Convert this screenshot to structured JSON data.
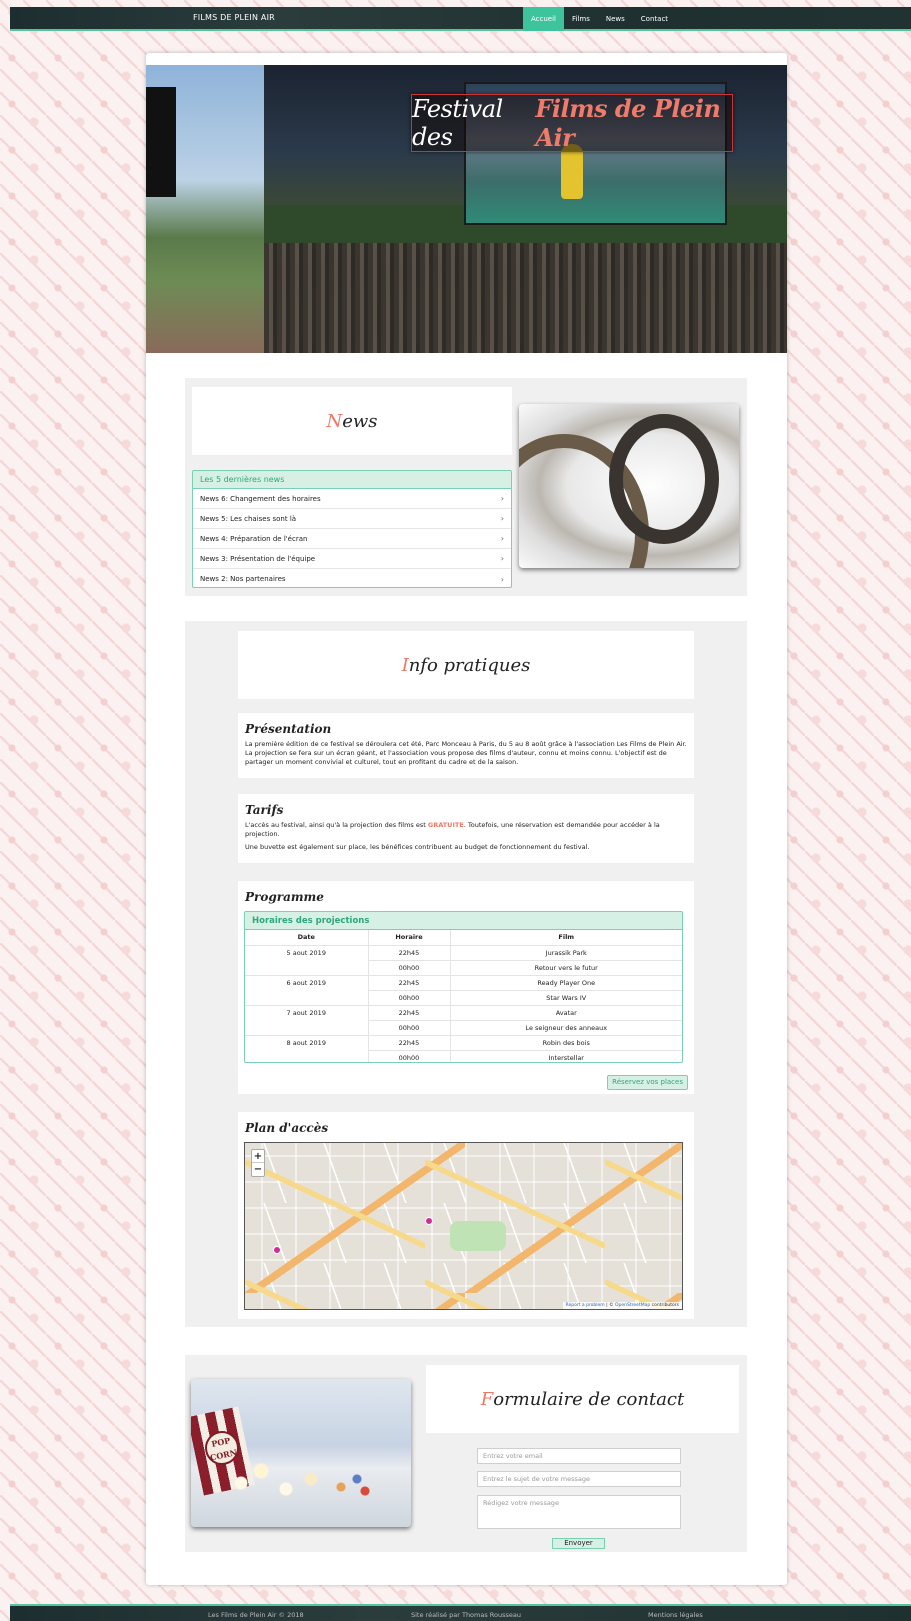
{
  "nav": {
    "brand": "FILMS DE PLEIN AIR",
    "links": [
      {
        "label": "Accueil",
        "active": true
      },
      {
        "label": "Films",
        "active": false
      },
      {
        "label": "News",
        "active": false
      },
      {
        "label": "Contact",
        "active": false
      }
    ]
  },
  "hero": {
    "title_part1": "Festival des",
    "title_part2": "Films de Plein Air"
  },
  "news": {
    "title_first": "N",
    "title_rest": "ews",
    "list_heading": "Les 5 dernières news",
    "items": [
      "News 6: Changement des horaires",
      "News 5: Les chaises sont là",
      "News 4: Préparation de l'écran",
      "News 3: Présentation de l'équipe",
      "News 2: Nos partenaires"
    ],
    "chevron": "›"
  },
  "info": {
    "title_first": "I",
    "title_rest": "nfo pratiques",
    "presentation": {
      "heading": "Présentation",
      "text": "La première édition de ce festival se déroulera cet été, Parc Monceau à Paris, du 5 au 8 août grâce à l'association Les Films de Plein Air. La projection se fera sur un écran géant, et l'association vous propose des films d'auteur, connu et moins connu. L'objectif est de partager un moment convivial et culturel, tout en profitant du cadre et de la saison."
    },
    "tarifs": {
      "heading": "Tarifs",
      "text_before": "L'accès au festival, ainsi qu'à la projection des films est ",
      "highlight": "GRATUITE",
      "text_after": ". Toutefois, une réservation est demandée pour accéder à la projection.",
      "text2": "Une buvette est également sur place, les bénéfices contribuent au budget de fonctionnement du festival."
    },
    "programme": {
      "heading": "Programme",
      "table_heading": "Horaires des projections",
      "columns": [
        "Date",
        "Horaire",
        "Film"
      ],
      "days": [
        {
          "date": "5 aout 2019",
          "rows": [
            [
              "22h45",
              "Jurassik Park"
            ],
            [
              "00h00",
              "Retour vers le futur"
            ]
          ]
        },
        {
          "date": "6 aout 2019",
          "rows": [
            [
              "22h45",
              "Ready Player One"
            ],
            [
              "00h00",
              "Star Wars IV"
            ]
          ]
        },
        {
          "date": "7 aout 2019",
          "rows": [
            [
              "22h45",
              "Avatar"
            ],
            [
              "00h00",
              "Le seigneur des anneaux"
            ]
          ]
        },
        {
          "date": "8 aout 2019",
          "rows": [
            [
              "22h45",
              "Robin des bois"
            ],
            [
              "00h00",
              "Interstellar"
            ]
          ]
        }
      ],
      "reserve_label": "Réservez vos places"
    },
    "map": {
      "heading": "Plan d'accès",
      "zoom_in": "+",
      "zoom_out": "−",
      "attrib_report": "Report a problem",
      "attrib_sep": " | © ",
      "attrib_osm": "OpenStreetMap",
      "attrib_rest": " contributors"
    }
  },
  "contact": {
    "title_first": "F",
    "title_rest": "ormulaire de contact",
    "popcorn_label": "POP CORN",
    "email_placeholder": "Entrez votre email",
    "subject_placeholder": "Entrez le sujet de votre message",
    "message_placeholder": "Rédigez votre message",
    "send_label": "Envoyer"
  },
  "footer": {
    "copyright": "Les Films de Plein Air © 2018",
    "credit": "Site réalisé par Thomas Rousseau",
    "legal": "Mentions légales"
  },
  "colors": {
    "accent": "#3ec49c",
    "highlight": "#ee7866",
    "panel_border": "#79d0b2",
    "panel_header": "#d7f0e6"
  }
}
